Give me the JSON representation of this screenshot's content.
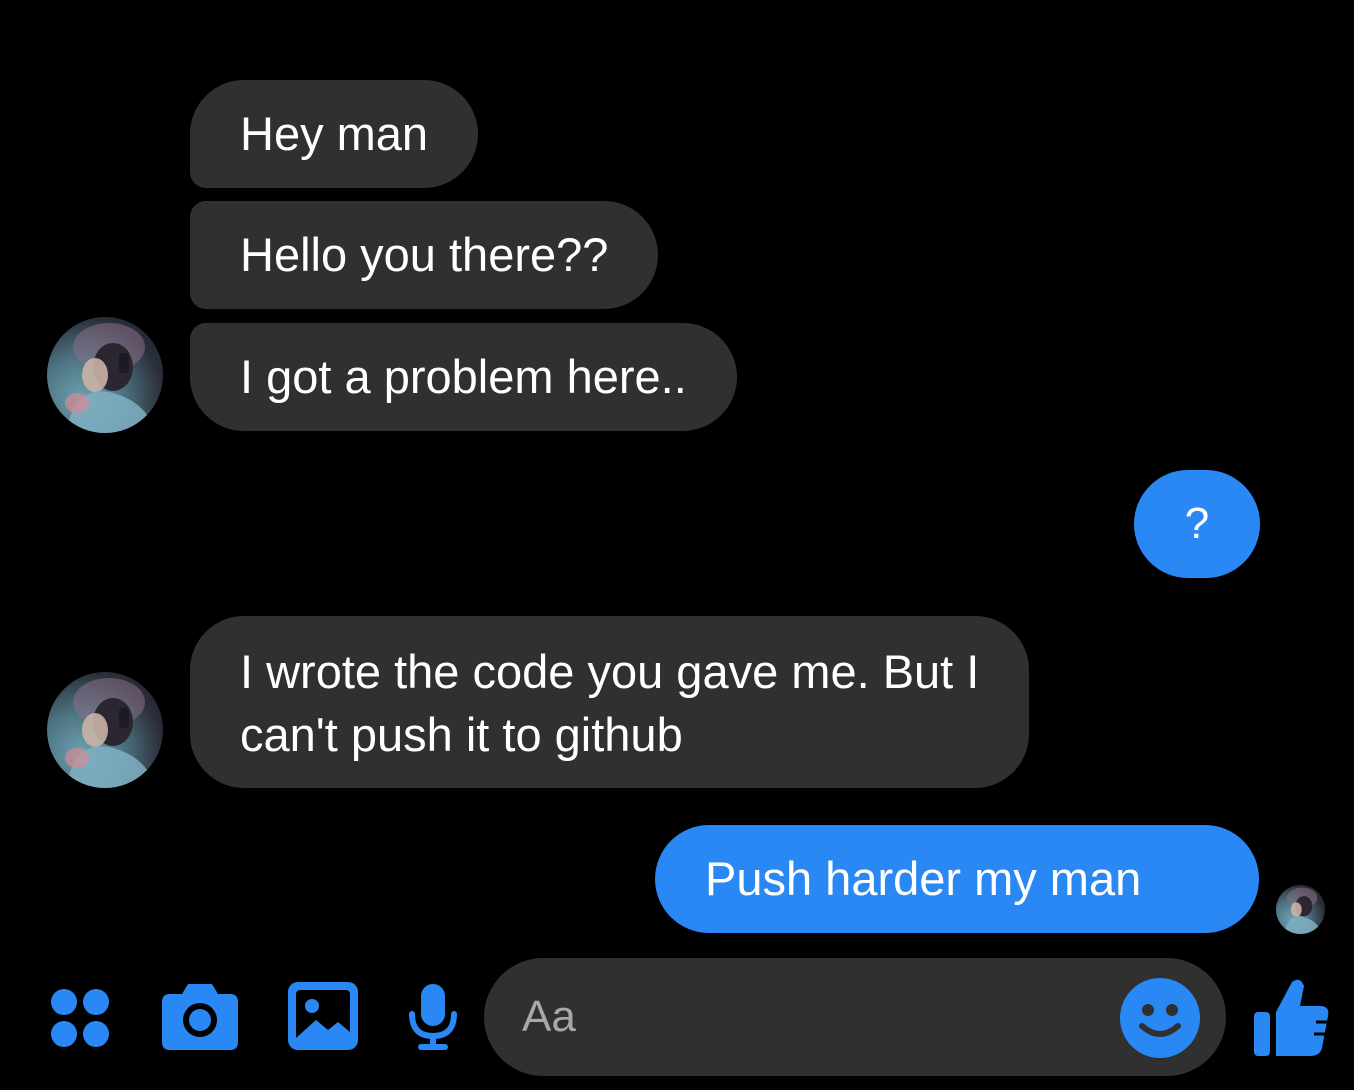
{
  "conversation": {
    "messages": [
      {
        "from": "them",
        "text": "Hey man"
      },
      {
        "from": "them",
        "text": "Hello you there??"
      },
      {
        "from": "them",
        "text": "I got a problem here.."
      },
      {
        "from": "me",
        "text": "?"
      },
      {
        "from": "them",
        "text": "I wrote the code you gave me. But I",
        "text_line2": "can't push it to github"
      },
      {
        "from": "me",
        "text": "Push harder my man"
      }
    ]
  },
  "composer": {
    "placeholder": "Aa",
    "icons": [
      "menu-dots-icon",
      "camera-icon",
      "gallery-icon",
      "microphone-icon",
      "emoji-icon",
      "thumbs-up-icon"
    ]
  },
  "colors": {
    "background": "#000000",
    "incoming_bubble": "#303030",
    "outgoing_bubble": "#2a88f5",
    "accent": "#2a88f5"
  }
}
